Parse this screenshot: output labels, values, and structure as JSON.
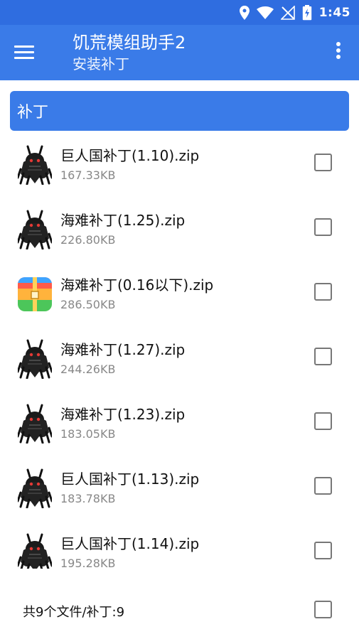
{
  "status_bar": {
    "time": "1:45",
    "icons": [
      "location-icon",
      "wifi-icon",
      "no-signal-icon",
      "battery-charging-icon"
    ]
  },
  "app_bar": {
    "title": "饥荒模组助手2",
    "subtitle": "安装补丁",
    "menu_icon": "hamburger-menu-icon",
    "overflow_icon": "more-vert-icon"
  },
  "section": {
    "title": "补丁"
  },
  "files": [
    {
      "name": "巨人国补丁(1.10).zip",
      "size": "167.33KB",
      "icon": "monster-icon",
      "checked": false
    },
    {
      "name": "海难补丁(1.25).zip",
      "size": "226.80KB",
      "icon": "monster-icon",
      "checked": false
    },
    {
      "name": "海难补丁(0.16以下).zip",
      "size": "286.50KB",
      "icon": "archive-icon",
      "checked": false
    },
    {
      "name": "海难补丁(1.27).zip",
      "size": "244.26KB",
      "icon": "monster-icon",
      "checked": false
    },
    {
      "name": "海难补丁(1.23).zip",
      "size": "183.05KB",
      "icon": "monster-icon",
      "checked": false
    },
    {
      "name": "巨人国补丁(1.13).zip",
      "size": "183.78KB",
      "icon": "monster-icon",
      "checked": false
    },
    {
      "name": "巨人国补丁(1.14).zip",
      "size": "195.28KB",
      "icon": "monster-icon",
      "checked": false
    }
  ],
  "footer": {
    "summary": "共9个文件/补丁:9",
    "select_all_checked": false
  },
  "colors": {
    "status_bar": "#2f6de0",
    "app_bar": "#3a7be8",
    "section_header": "#3a7be8"
  }
}
